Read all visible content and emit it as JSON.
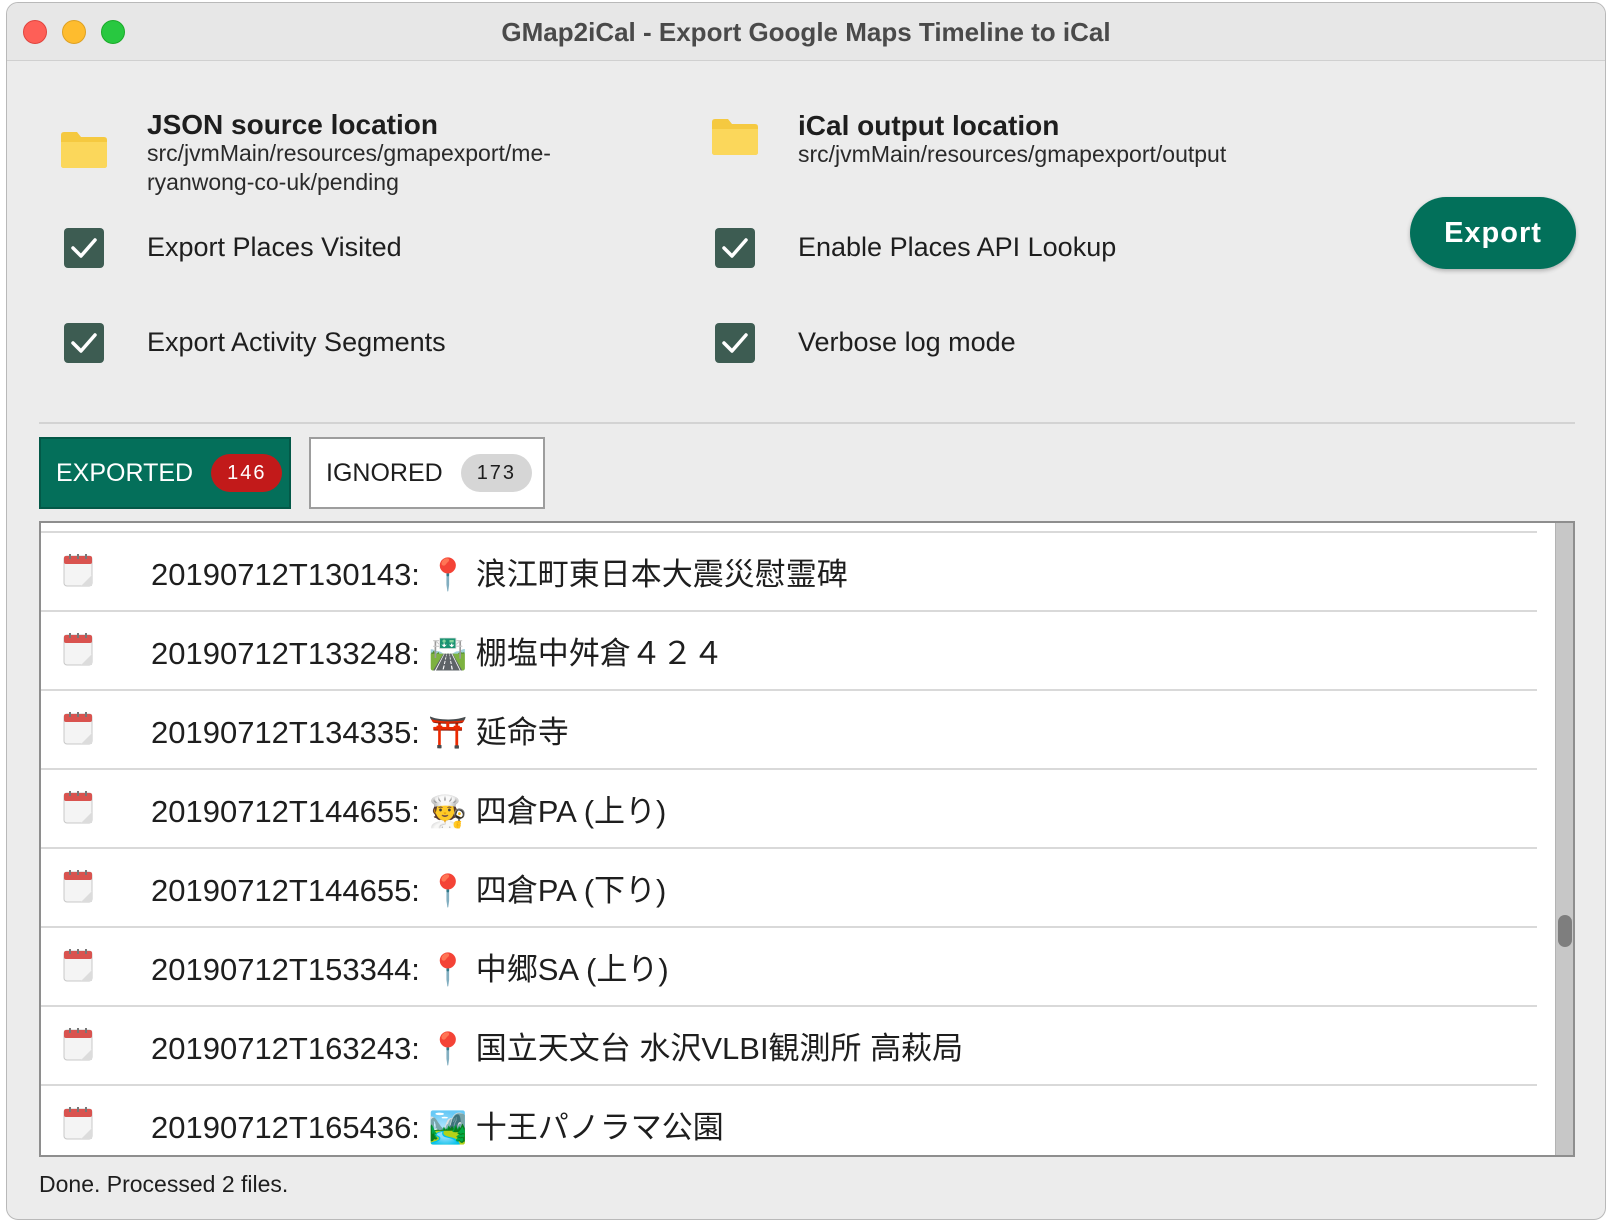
{
  "window": {
    "title": "GMap2iCal - Export Google Maps Timeline to iCal"
  },
  "source": {
    "title": "JSON source location",
    "path_line1": "src/jvmMain/resources/gmapexport/me-",
    "path_line2": "ryanwong-co-uk/pending",
    "icon": "folder-icon"
  },
  "output": {
    "title": "iCal output location",
    "path": "src/jvmMain/resources/gmapexport/output",
    "icon": "folder-icon"
  },
  "options": {
    "export_places": {
      "label": "Export Places Visited",
      "checked": true
    },
    "enable_places_api": {
      "label": "Enable Places API Lookup",
      "checked": true
    },
    "export_activity": {
      "label": "Export Activity Segments",
      "checked": true
    },
    "verbose_log": {
      "label": "Verbose log mode",
      "checked": true
    }
  },
  "export_button": {
    "label": "Export"
  },
  "tabs": [
    {
      "label": "EXPORTED",
      "count": "146",
      "selected": true
    },
    {
      "label": "IGNORED",
      "count": "173",
      "selected": false
    }
  ],
  "entries": [
    {
      "text": "20190712T130143: 📍 浪江町東日本大震災慰霊碑",
      "icon": "calendar-icon"
    },
    {
      "text": "20190712T133248: 🛣️ 棚塩中舛倉４２４",
      "icon": "calendar-icon"
    },
    {
      "text": "20190712T134335: ⛩️ 延命寺",
      "icon": "calendar-icon"
    },
    {
      "text": "20190712T144655: 🧑‍🍳 四倉PA (上り)",
      "icon": "calendar-icon"
    },
    {
      "text": "20190712T144655: 📍 四倉PA (下り)",
      "icon": "calendar-icon"
    },
    {
      "text": "20190712T153344: 📍 中郷SA (上り)",
      "icon": "calendar-icon"
    },
    {
      "text": "20190712T163243: 📍 国立天文台 水沢VLBI観測所 高萩局",
      "icon": "calendar-icon"
    },
    {
      "text": "20190712T165436: 🏞️ 十王パノラマ公園",
      "icon": "calendar-icon"
    }
  ],
  "status": {
    "text": "Done. Processed 2 files."
  },
  "colors": {
    "accent": "#02705a",
    "checkbox": "#3d5c52",
    "badge_exported": "#c21a1a",
    "badge_ignored": "#d6d6d6",
    "folder": "#fbd75b"
  }
}
